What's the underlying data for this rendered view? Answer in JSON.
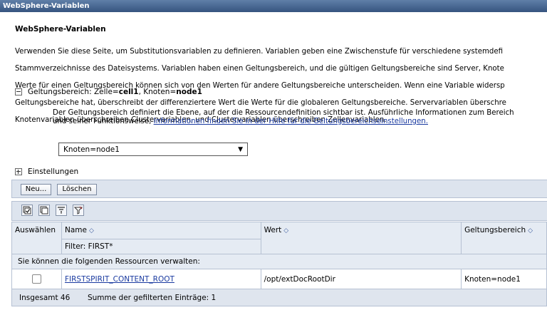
{
  "window": {
    "title": "WebSphere-Variablen"
  },
  "page": {
    "heading": "WebSphere-Variablen",
    "description_lines": [
      "Verwenden Sie diese Seite, um Substitutionsvariablen zu definieren. Variablen geben eine Zwischenstufe für verschiedene systemdefi",
      "Stammverzeichnisse des Dateisystems. Variablen haben einen Geltungsbereich, und die gültigen Geltungsbereiche sind Server, Knote",
      "Werte für einen Geltungsbereich können sich von den Werten für andere Geltungsbereiche unterscheiden. Wenn eine Variable widersp",
      "Geltungsbereiche hat, überschreibt der differenziertere Wert die Werte für die globaleren Geltungsbereiche. Servervariablen überschre",
      "Knotenvariablen überschreiben Clustervariablen, und Clustervariablen überschreiben Zellenvariablen."
    ]
  },
  "scope": {
    "label_prefix": "Geltungsbereich: Zelle=",
    "cell": "cell1",
    "label_mid": ", Knoten=",
    "node": "node1",
    "description": "Der Geltungsbereich definiert die Ebene, auf der die Ressourcendefinition sichtbar ist. Ausführliche Informationen zum Bereich und seiner Funktionsweise, ",
    "help_link": "Informationen finden Sie in der Hilfe für die Geltungsbereichseinstellungen.",
    "selected": "Knoten=node1"
  },
  "settings": {
    "label": "Einstellungen"
  },
  "toolbar": {
    "new_label": "Neu...",
    "delete_label": "Löschen"
  },
  "table": {
    "columns": {
      "select": "Auswählen",
      "name": "Name",
      "value": "Wert",
      "scope": "Geltungsbereich"
    },
    "filter": "Filter: FIRST*",
    "notice": "Sie können die folgenden Ressourcen verwalten:",
    "rows": [
      {
        "name": "FIRSTSPIRIT_CONTENT_ROOT",
        "value": "/opt/extDocRootDir",
        "scope": "Knoten=node1"
      }
    ],
    "footer": {
      "total": "Insgesamt 46",
      "filtered": "Summe der gefilterten Einträge: 1"
    }
  },
  "icons": [
    "select-all-icon",
    "deselect-all-icon",
    "show-filter-icon",
    "clear-filter-icon",
    "sort-icon"
  ]
}
